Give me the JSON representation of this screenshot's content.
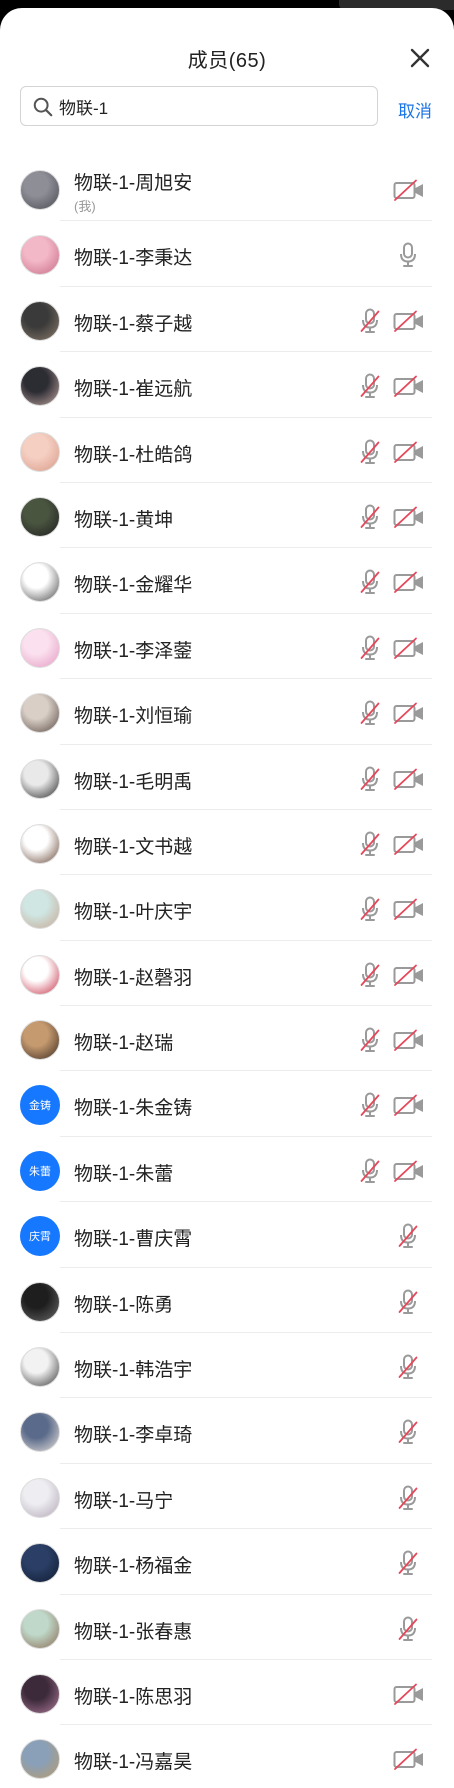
{
  "header": {
    "title": "成员(65)"
  },
  "search": {
    "value": "物联-1",
    "cancel_label": "取消"
  },
  "icons": {
    "close": "close-icon",
    "search": "search-icon",
    "mic": "mic-icon",
    "mic_off": "mic-off-icon",
    "camera_off": "camera-off-icon"
  },
  "colors": {
    "accent": "#1a73e8",
    "avatar_blue": "#1677ff",
    "icon_gray": "#9a9a9a",
    "strike_red": "#e6475a"
  },
  "members": [
    {
      "name": "物联-1-周旭安",
      "sub": "(我)",
      "avatar_bg": [
        "#8e8e96",
        "#4a4a52"
      ],
      "mic": "none",
      "camera_off": true
    },
    {
      "name": "物联-1-李秉达",
      "sub": "",
      "avatar_bg": [
        "#f3b8c8",
        "#c96c86"
      ],
      "mic": "on",
      "camera_off": false
    },
    {
      "name": "物联-1-蔡子越",
      "sub": "",
      "avatar_bg": [
        "#3a3a3a",
        "#8a7b6a"
      ],
      "mic": "off",
      "camera_off": true
    },
    {
      "name": "物联-1-崔远航",
      "sub": "",
      "avatar_bg": [
        "#2c2c33",
        "#c0a5a0"
      ],
      "mic": "off",
      "camera_off": true
    },
    {
      "name": "物联-1-杜皓鸽",
      "sub": "",
      "avatar_bg": [
        "#f5cfc2",
        "#d89a88"
      ],
      "mic": "off",
      "camera_off": true
    },
    {
      "name": "物联-1-黄坤",
      "sub": "",
      "avatar_bg": [
        "#4a5540",
        "#1f1f1f"
      ],
      "mic": "off",
      "camera_off": true
    },
    {
      "name": "物联-1-金耀华",
      "sub": "",
      "avatar_bg": [
        "#ffffff",
        "#4a4a4a"
      ],
      "mic": "off",
      "camera_off": true
    },
    {
      "name": "物联-1-李泽蓥",
      "sub": "",
      "avatar_bg": [
        "#fbe1ef",
        "#e59ac3"
      ],
      "mic": "off",
      "camera_off": true
    },
    {
      "name": "物联-1-刘恒瑜",
      "sub": "",
      "avatar_bg": [
        "#d9cfc6",
        "#5a4b45"
      ],
      "mic": "off",
      "camera_off": true
    },
    {
      "name": "物联-1-毛明禹",
      "sub": "",
      "avatar_bg": [
        "#e9e9e9",
        "#2a2a2a"
      ],
      "mic": "off",
      "camera_off": true
    },
    {
      "name": "物联-1-文书越",
      "sub": "",
      "avatar_bg": [
        "#ffffff",
        "#6b4b3a"
      ],
      "mic": "off",
      "camera_off": true
    },
    {
      "name": "物联-1-叶庆宇",
      "sub": "",
      "avatar_bg": [
        "#cfe6e3",
        "#c7a893"
      ],
      "mic": "off",
      "camera_off": true
    },
    {
      "name": "物联-1-赵磬羽",
      "sub": "",
      "avatar_bg": [
        "#ffffff",
        "#c8344a"
      ],
      "mic": "off",
      "camera_off": true
    },
    {
      "name": "物联-1-赵瑞",
      "sub": "",
      "avatar_bg": [
        "#c59a6f",
        "#3c2b22"
      ],
      "mic": "off",
      "camera_off": true
    },
    {
      "name": "物联-1-朱金铸",
      "sub": "",
      "avatar_text": "金铸",
      "mic": "off",
      "camera_off": true
    },
    {
      "name": "物联-1-朱蕾",
      "sub": "",
      "avatar_text": "朱蕾",
      "mic": "off",
      "camera_off": true
    },
    {
      "name": "物联-1-曹庆霄",
      "sub": "",
      "avatar_text": "庆霄",
      "mic": "off",
      "camera_off": false
    },
    {
      "name": "物联-1-陈勇",
      "sub": "",
      "avatar_bg": [
        "#1e1e1e",
        "#6a6a6a"
      ],
      "mic": "off",
      "camera_off": false
    },
    {
      "name": "物联-1-韩浩宇",
      "sub": "",
      "avatar_bg": [
        "#f2f2f2",
        "#3a3a3a"
      ],
      "mic": "off",
      "camera_off": false
    },
    {
      "name": "物联-1-李卓琦",
      "sub": "",
      "avatar_bg": [
        "#5a6a8a",
        "#e8e2dc"
      ],
      "mic": "off",
      "camera_off": false
    },
    {
      "name": "物联-1-马宁",
      "sub": "",
      "avatar_bg": [
        "#eeeef2",
        "#b3a7b6"
      ],
      "mic": "off",
      "camera_off": false
    },
    {
      "name": "物联-1-杨福金",
      "sub": "",
      "avatar_bg": [
        "#2b3f66",
        "#0e1a30"
      ],
      "mic": "off",
      "camera_off": false
    },
    {
      "name": "物联-1-张春惠",
      "sub": "",
      "avatar_bg": [
        "#bfd8c9",
        "#8a6b52"
      ],
      "mic": "off",
      "camera_off": false
    },
    {
      "name": "物联-1-陈思羽",
      "sub": "",
      "avatar_bg": [
        "#3c2a3a",
        "#b07a9a"
      ],
      "mic": "none",
      "camera_off": true
    },
    {
      "name": "物联-1-冯嘉昊",
      "sub": "",
      "avatar_bg": [
        "#8aa0b8",
        "#b89a6a"
      ],
      "mic": "none",
      "camera_off": true
    }
  ]
}
